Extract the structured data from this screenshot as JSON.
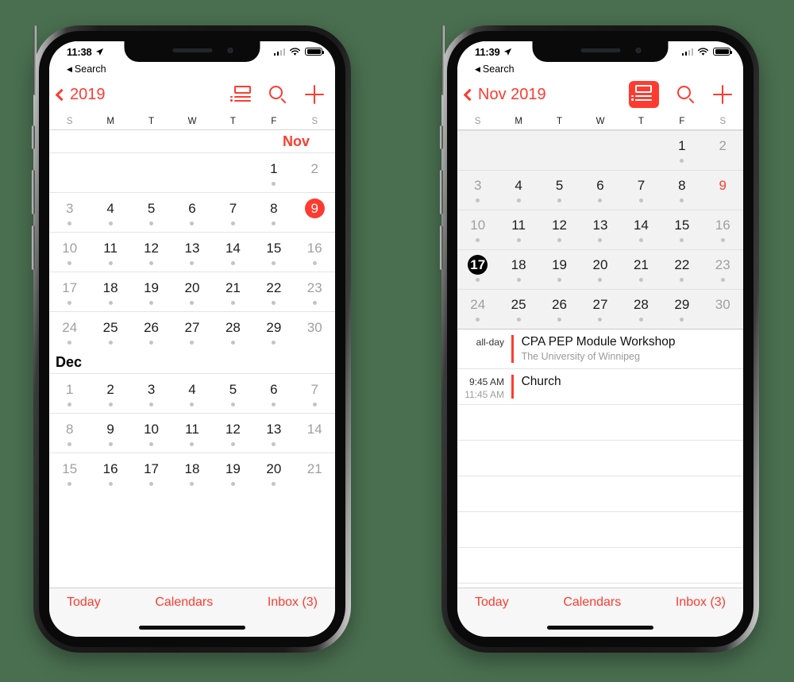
{
  "background_color": "#4a6f50",
  "accent_color": "#ff3b30",
  "phones": [
    {
      "id": "left",
      "status": {
        "time": "11:38",
        "location_icon": "location-arrow-icon",
        "signal_icon": "cellular-bars-icon",
        "wifi_icon": "wifi-icon",
        "battery_icon": "battery-full-icon"
      },
      "back_to_app": {
        "label": "Search",
        "icon": "back-triangle-icon"
      },
      "navbar": {
        "back_label": "2019",
        "back_icon": "chevron-left-icon",
        "list_icon": "list-view-icon",
        "search_icon": "search-icon",
        "add_icon": "plus-icon",
        "list_icon_active": false
      },
      "weekdays": [
        "S",
        "M",
        "T",
        "W",
        "T",
        "F",
        "S"
      ],
      "months": [
        {
          "label": "Nov",
          "label_color": "red",
          "label_align": "right",
          "weeks": [
            [
              {
                "day": "",
                "empty": true
              },
              {
                "day": "",
                "empty": true
              },
              {
                "day": "",
                "empty": true
              },
              {
                "day": "",
                "empty": true
              },
              {
                "day": "",
                "empty": true
              },
              {
                "day": "1",
                "dot": true
              },
              {
                "day": "2",
                "dim": true,
                "dot": false
              }
            ],
            [
              {
                "day": "3",
                "dim": true,
                "dot": true
              },
              {
                "day": "4",
                "dot": true
              },
              {
                "day": "5",
                "dot": true
              },
              {
                "day": "6",
                "dot": true
              },
              {
                "day": "7",
                "dot": true
              },
              {
                "day": "8",
                "dot": true
              },
              {
                "day": "9",
                "highlight": "today-red",
                "dot": false
              }
            ],
            [
              {
                "day": "10",
                "dim": true,
                "dot": true
              },
              {
                "day": "11",
                "dot": true
              },
              {
                "day": "12",
                "dot": true
              },
              {
                "day": "13",
                "dot": true
              },
              {
                "day": "14",
                "dot": true
              },
              {
                "day": "15",
                "dot": true
              },
              {
                "day": "16",
                "dim": true,
                "dot": true
              }
            ],
            [
              {
                "day": "17",
                "dim": true,
                "dot": true
              },
              {
                "day": "18",
                "dot": true
              },
              {
                "day": "19",
                "dot": true
              },
              {
                "day": "20",
                "dot": true
              },
              {
                "day": "21",
                "dot": true
              },
              {
                "day": "22",
                "dot": true
              },
              {
                "day": "23",
                "dim": true,
                "dot": true
              }
            ],
            [
              {
                "day": "24",
                "dim": true,
                "dot": true
              },
              {
                "day": "25",
                "dot": true
              },
              {
                "day": "26",
                "dot": true
              },
              {
                "day": "27",
                "dot": true
              },
              {
                "day": "28",
                "dot": true
              },
              {
                "day": "29",
                "dot": true
              },
              {
                "day": "30",
                "dim": true,
                "dot": false
              }
            ]
          ]
        },
        {
          "label": "Dec",
          "label_color": "black",
          "label_align": "left",
          "weeks": [
            [
              {
                "day": "1",
                "dim": true,
                "dot": true
              },
              {
                "day": "2",
                "dot": true
              },
              {
                "day": "3",
                "dot": true
              },
              {
                "day": "4",
                "dot": true
              },
              {
                "day": "5",
                "dot": true
              },
              {
                "day": "6",
                "dot": true
              },
              {
                "day": "7",
                "dim": true,
                "dot": true
              }
            ],
            [
              {
                "day": "8",
                "dim": true,
                "dot": true
              },
              {
                "day": "9",
                "dot": true
              },
              {
                "day": "10",
                "dot": true
              },
              {
                "day": "11",
                "dot": true
              },
              {
                "day": "12",
                "dot": true
              },
              {
                "day": "13",
                "dot": true
              },
              {
                "day": "14",
                "dim": true,
                "dot": false
              }
            ],
            [
              {
                "day": "15",
                "dim": true,
                "dot": true
              },
              {
                "day": "16",
                "dot": true
              },
              {
                "day": "17",
                "dot": true
              },
              {
                "day": "18",
                "dot": true
              },
              {
                "day": "19",
                "dot": true
              },
              {
                "day": "20",
                "dot": true
              },
              {
                "day": "21",
                "dim": true,
                "dot": false
              }
            ]
          ]
        }
      ],
      "toolbar": {
        "today": "Today",
        "calendars": "Calendars",
        "inbox": "Inbox (3)"
      }
    },
    {
      "id": "right",
      "status": {
        "time": "11:39",
        "location_icon": "location-arrow-icon",
        "signal_icon": "cellular-bars-icon",
        "wifi_icon": "wifi-icon",
        "battery_icon": "battery-full-icon"
      },
      "back_to_app": {
        "label": "Search",
        "icon": "back-triangle-icon"
      },
      "navbar": {
        "back_label": "Nov 2019",
        "back_icon": "chevron-left-icon",
        "list_icon": "list-view-icon",
        "search_icon": "search-icon",
        "add_icon": "plus-icon",
        "list_icon_active": true
      },
      "weekdays": [
        "S",
        "M",
        "T",
        "W",
        "T",
        "F",
        "S"
      ],
      "grid_weeks": [
        [
          {
            "day": "",
            "empty": true
          },
          {
            "day": "",
            "empty": true
          },
          {
            "day": "",
            "empty": true
          },
          {
            "day": "",
            "empty": true
          },
          {
            "day": "",
            "empty": true
          },
          {
            "day": "1",
            "dot": true
          },
          {
            "day": "2",
            "dim": true,
            "dot": false
          }
        ],
        [
          {
            "day": "3",
            "dim": true,
            "dot": true
          },
          {
            "day": "4",
            "dot": true
          },
          {
            "day": "5",
            "dot": true
          },
          {
            "day": "6",
            "dot": true
          },
          {
            "day": "7",
            "dot": true
          },
          {
            "day": "8",
            "dot": true
          },
          {
            "day": "9",
            "highlight": "red-text",
            "dot": false
          }
        ],
        [
          {
            "day": "10",
            "dim": true,
            "dot": true
          },
          {
            "day": "11",
            "dot": true
          },
          {
            "day": "12",
            "dot": true
          },
          {
            "day": "13",
            "dot": true
          },
          {
            "day": "14",
            "dot": true
          },
          {
            "day": "15",
            "dot": true
          },
          {
            "day": "16",
            "dim": true,
            "dot": true
          }
        ],
        [
          {
            "day": "17",
            "highlight": "sel-black",
            "dot": true
          },
          {
            "day": "18",
            "dot": true
          },
          {
            "day": "19",
            "dot": true
          },
          {
            "day": "20",
            "dot": true
          },
          {
            "day": "21",
            "dot": true
          },
          {
            "day": "22",
            "dot": true
          },
          {
            "day": "23",
            "dim": true,
            "dot": true
          }
        ],
        [
          {
            "day": "24",
            "dim": true,
            "dot": true
          },
          {
            "day": "25",
            "dot": true
          },
          {
            "day": "26",
            "dot": true
          },
          {
            "day": "27",
            "dot": true
          },
          {
            "day": "28",
            "dot": true
          },
          {
            "day": "29",
            "dot": true
          },
          {
            "day": "30",
            "dim": true,
            "dot": false
          }
        ]
      ],
      "events": [
        {
          "time_start": "all-day",
          "time_end": "",
          "title": "CPA PEP Module Workshop",
          "subtitle": "The University of Winnipeg",
          "bar_color": "#ff3b30"
        },
        {
          "time_start": "9:45 AM",
          "time_end": "11:45 AM",
          "title": "Church",
          "subtitle": "",
          "bar_color": "#ff3b30"
        }
      ],
      "empty_rows": 5,
      "toolbar": {
        "today": "Today",
        "calendars": "Calendars",
        "inbox": "Inbox (3)"
      }
    }
  ]
}
